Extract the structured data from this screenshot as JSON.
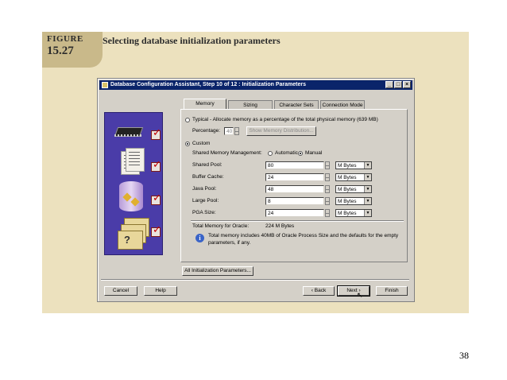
{
  "figure": {
    "label_word": "FIGURE",
    "label_number": "15.27",
    "title": "Selecting database initialization parameters"
  },
  "window": {
    "title": "Database Configuration Assistant, Step 10 of 12 : Initialization Parameters",
    "controls": {
      "minimize": "_",
      "maximize": "□",
      "close": "×"
    }
  },
  "tabs": [
    {
      "label": "Memory",
      "active": true
    },
    {
      "label": "Sizing",
      "active": false
    },
    {
      "label": "Character Sets",
      "active": false
    },
    {
      "label": "Connection Mode",
      "active": false
    }
  ],
  "memory": {
    "typical_label": "Typical - Allocate memory as a percentage of the total physical memory (639 MB)",
    "typical_selected": false,
    "percentage_label": "Percentage:",
    "percentage_value": "40",
    "show_distribution_button": "Show Memory Distribution...",
    "custom_label": "Custom",
    "custom_selected": true,
    "shared_mgmt_label": "Shared Memory Management:",
    "automatic_label": "Automatic",
    "automatic_selected": false,
    "manual_label": "Manual",
    "manual_selected": true,
    "pools": [
      {
        "label": "Shared Pool:",
        "value": "80",
        "unit": "M Bytes"
      },
      {
        "label": "Buffer Cache:",
        "value": "24",
        "unit": "M Bytes"
      },
      {
        "label": "Java Pool:",
        "value": "48",
        "unit": "M Bytes"
      },
      {
        "label": "Large Pool:",
        "value": "8",
        "unit": "M Bytes"
      },
      {
        "label": "PGA Size:",
        "value": "24",
        "unit": "M Bytes"
      }
    ],
    "total_label": "Total Memory for Oracle:",
    "total_value": "224 M Bytes",
    "info_line1": "Total memory includes 40MB of Oracle Process Size and the defaults for the empty",
    "info_line2": "parameters, if any."
  },
  "all_params_button": "All Initialization Parameters...",
  "bottom_buttons": {
    "cancel": "Cancel",
    "help": "Help",
    "back": "Back",
    "next": "Next",
    "finish": "Finish"
  },
  "page_number": "38"
}
